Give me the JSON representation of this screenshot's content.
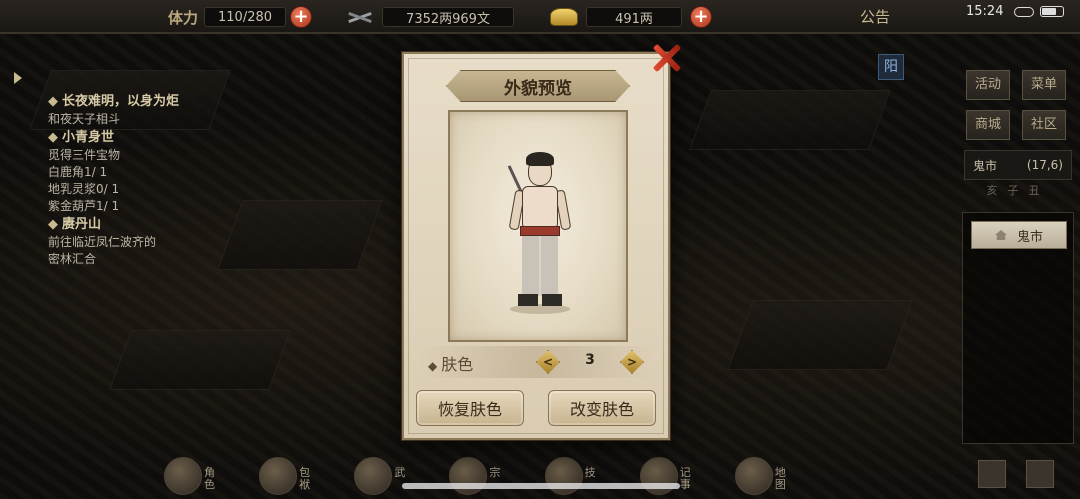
{
  "topbar": {
    "stamina_label": "体力",
    "stamina_value": "110/280",
    "silver_value": "7352两969文",
    "gold_value": "491两",
    "notice": "公告"
  },
  "status": {
    "time": "15:24"
  },
  "quests": [
    {
      "title": "长夜难明，以身为炬",
      "lines": [
        "和夜天子相斗"
      ]
    },
    {
      "title": "小青身世",
      "lines": [
        "觅得三件宝物",
        "白鹿角1/ 1",
        "地乳灵浆0/ 1",
        "紫金葫芦1/ 1"
      ]
    },
    {
      "title": "赓丹山",
      "lines": [
        "前往临近凤仁波齐的",
        "密林汇合"
      ]
    }
  ],
  "right_menu": {
    "yang": "阳",
    "activity": "活动",
    "menu": "菜单",
    "mall": "商城",
    "community": "社区",
    "location": "鬼市",
    "coords": "(17,6)",
    "dial": "亥子丑",
    "location_list_item": "鬼市"
  },
  "bottom_bar": [
    {
      "label": "角色",
      "icon": "character-icon"
    },
    {
      "label": "包袱",
      "icon": "bag-icon"
    },
    {
      "label": "武",
      "icon": "martial-icon"
    },
    {
      "label": "宗",
      "icon": "sect-icon"
    },
    {
      "label": "技",
      "icon": "skill-icon"
    },
    {
      "label": "记事",
      "icon": "journal-icon"
    },
    {
      "label": "地图",
      "icon": "map-icon"
    }
  ],
  "modal": {
    "title": "外貌预览",
    "skin_label": "肤色",
    "skin_value": "3",
    "left_arrow": "<",
    "right_arrow": ">",
    "restore_button": "恢复肤色",
    "change_button": "改变肤色"
  }
}
